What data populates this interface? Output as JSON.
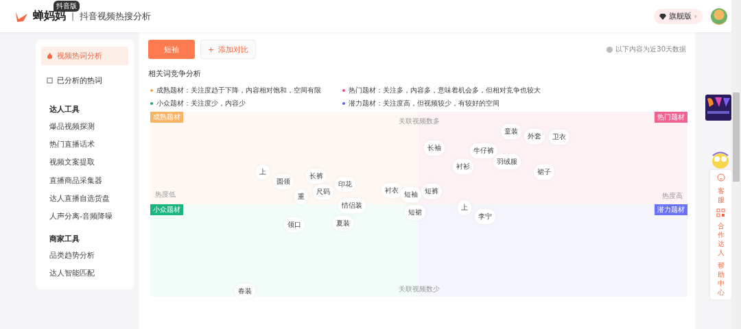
{
  "header": {
    "brand": "蝉妈妈",
    "edition_badge": "抖音版",
    "divider": "|",
    "subtitle": "抖音视频热搜分析",
    "plan_button": "旗舰版",
    "plan_caret": "›"
  },
  "sidebar": {
    "top_items": [
      {
        "label": "视频热词分析",
        "selected": true
      },
      {
        "label": "已分析的热词",
        "selected": false
      }
    ],
    "sections": [
      {
        "title": "达人工具",
        "items": [
          "爆品视频探测",
          "热门直播话术",
          "视频文案提取",
          "直播商品采集器",
          "达人直播自选货盘",
          "人声分离-音频降噪"
        ]
      },
      {
        "title": "商家工具",
        "items": [
          "品类趋势分析",
          "达人智能匹配"
        ]
      }
    ]
  },
  "toolbar": {
    "keyword_tab": "短袖",
    "add_compare": "添加对比",
    "add_icon": "+",
    "note": "以下内容为近30天数据"
  },
  "section_title": "相关词竞争分析",
  "legend": [
    {
      "text": "成熟题材：关注度趋于下降，内容相对饱和，空间有限",
      "color": "#f7a54a"
    },
    {
      "text": "热门题材：关注多，内容多，意味着机会多，但相对竞争也较大",
      "color": "#ec4f83"
    },
    {
      "text": "小众题材：关注度少，内容少",
      "color": "#13a86f"
    },
    {
      "text": "潜力题材：关注度高，但视频较少，有较好的空间",
      "color": "#5b63f0"
    }
  ],
  "quadrants": [
    {
      "label": "成熟题材",
      "color": "#f9b463"
    },
    {
      "label": "热门题材",
      "color": "#f0628f"
    },
    {
      "label": "小众题材",
      "color": "#1bb57f"
    },
    {
      "label": "潜力题材",
      "color": "#6b73f5"
    }
  ],
  "axis_labels": {
    "top": "关联视频数多",
    "bottom": "关联视频数少",
    "left": "热度低",
    "right": "热度高"
  },
  "words": [
    "上",
    "圆领",
    "长裤",
    "印花",
    "重",
    "尺码",
    "衬衣",
    "短袖",
    "短裤",
    "情侣装",
    "短裙",
    "领口",
    "夏装",
    "春装",
    "长袖",
    "童装",
    "外套",
    "卫衣",
    "牛仔裤",
    "羽绒服",
    "衬衫",
    "裙子",
    "上",
    "李宁"
  ],
  "float_panel": [
    "客服",
    "合作达人",
    "帮助中心"
  ]
}
